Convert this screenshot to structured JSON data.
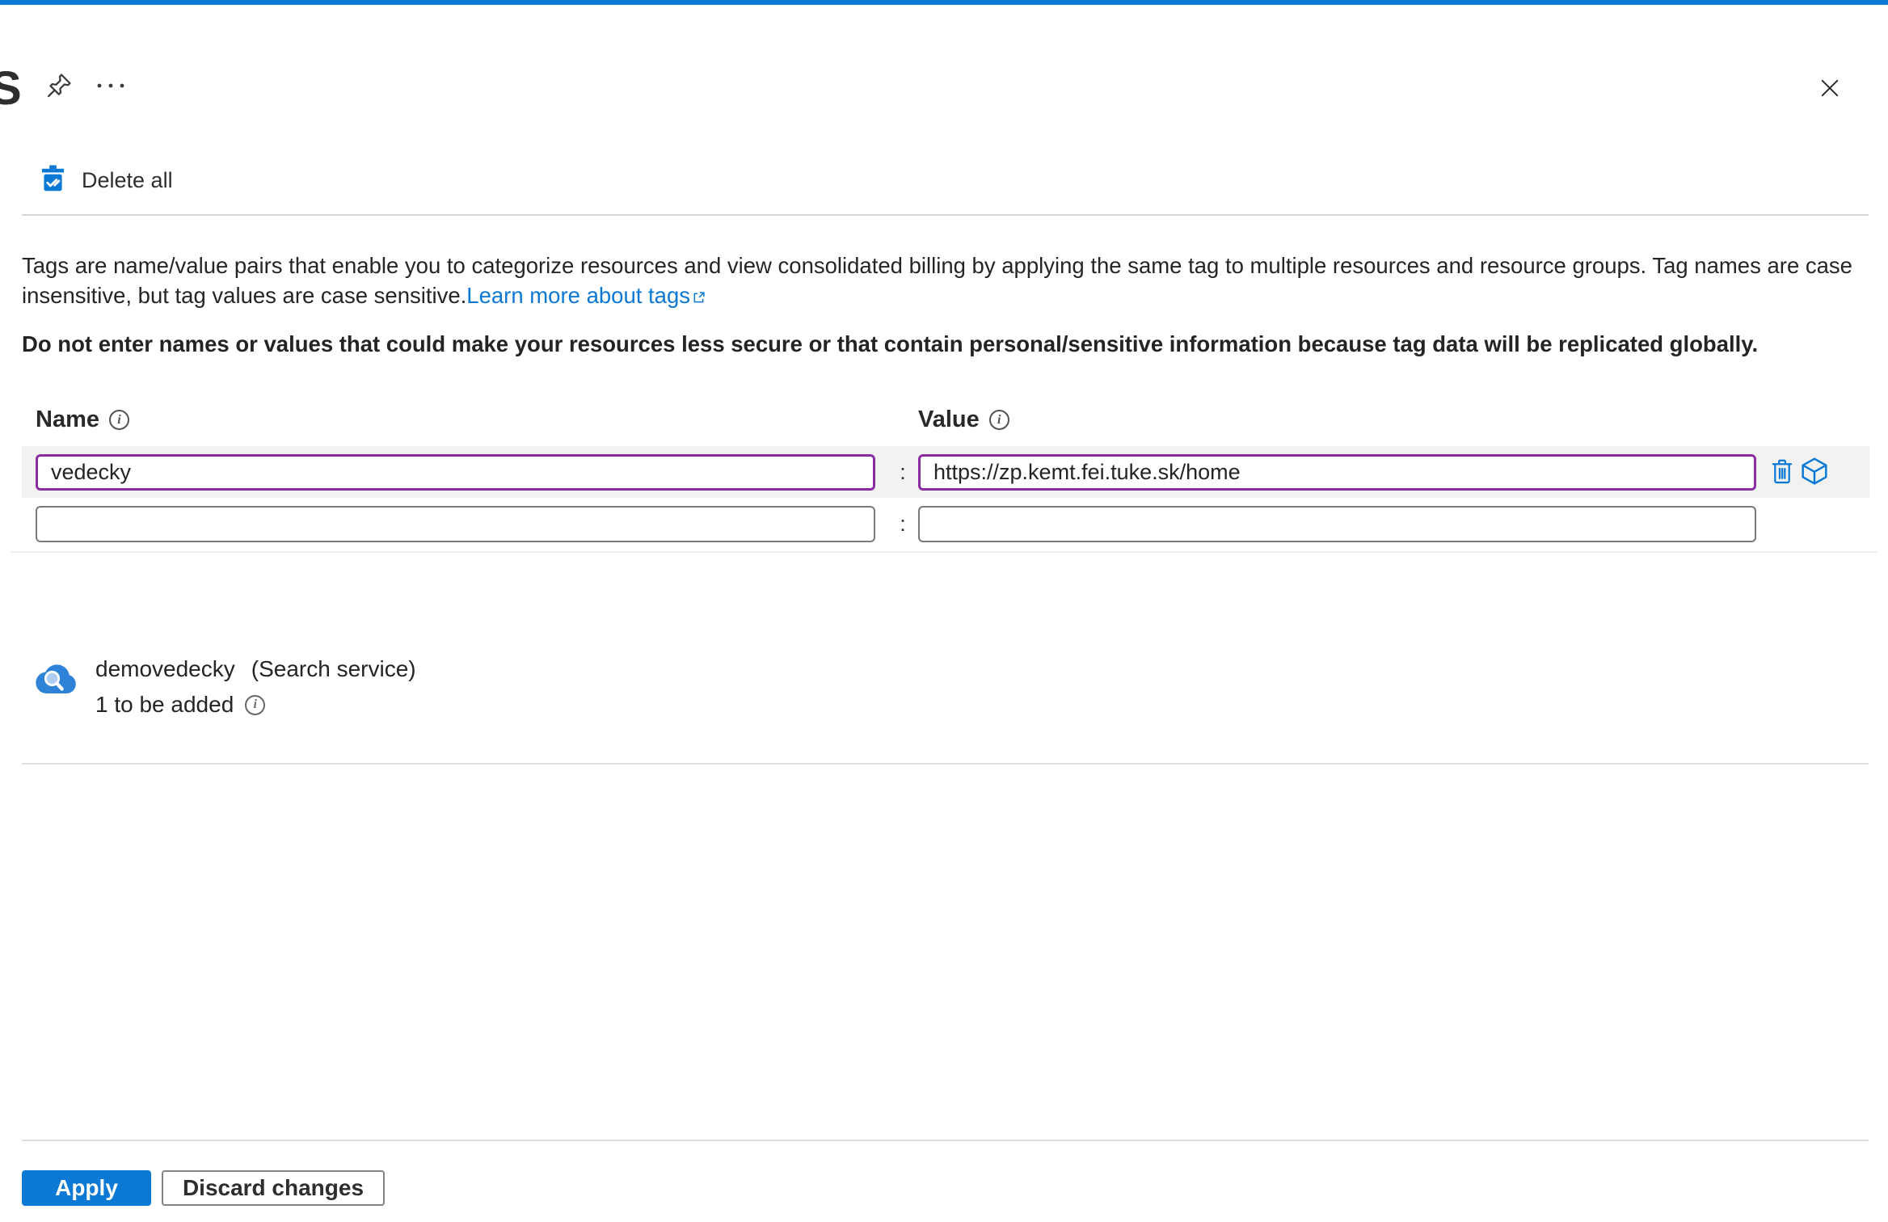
{
  "header": {
    "title_partial": "S"
  },
  "toolbar": {
    "delete_all_label": "Delete all"
  },
  "description": {
    "text": "Tags are name/value pairs that enable you to categorize resources and view consolidated billing by applying the same tag to multiple resources and resource groups. Tag names are case insensitive, but tag values are case sensitive.",
    "link_label": "Learn more about tags",
    "warning": "Do not enter names or values that could make your resources less secure or that contain personal/sensitive information because tag data will be replicated globally."
  },
  "editor": {
    "name_header": "Name",
    "value_header": "Value",
    "separator": ":",
    "rows": [
      {
        "name": "vedecky",
        "value": "https://zp.kemt.fei.tuke.sk/home",
        "modified": true
      },
      {
        "name": "",
        "value": "",
        "modified": false
      }
    ]
  },
  "resource": {
    "name": "demovedecky",
    "type": "(Search service)",
    "status": "1 to be added"
  },
  "footer": {
    "apply_label": "Apply",
    "discard_label": "Discard changes"
  },
  "colors": {
    "accent": "#0c79d4",
    "modified_border": "#8a2da5",
    "row_highlight": "#f2f2f1"
  }
}
